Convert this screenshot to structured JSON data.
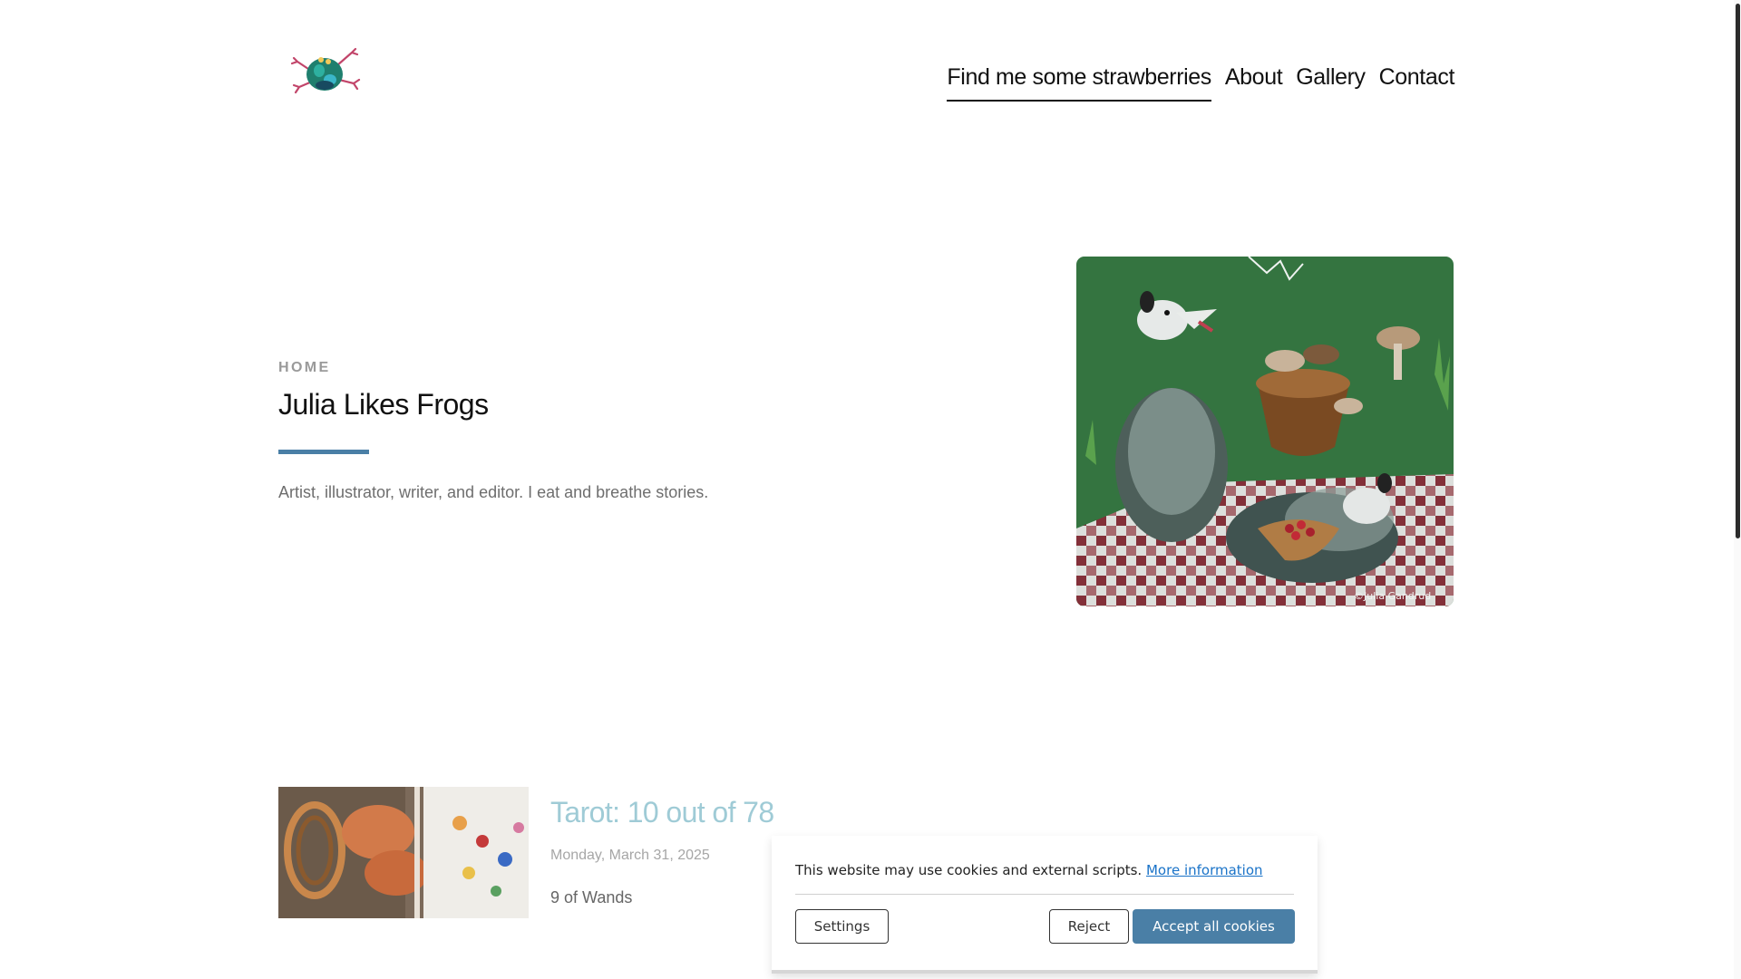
{
  "header": {
    "logo_alt": "frog logo",
    "nav": [
      {
        "label": "Find me some strawberries",
        "active": true
      },
      {
        "label": "About"
      },
      {
        "label": "Gallery"
      },
      {
        "label": "Contact"
      }
    ]
  },
  "hero": {
    "breadcrumb": "HOME",
    "title": "Julia Likes Frogs",
    "tagline": "Artist, illustrator, writer, and editor. I eat and breathe stories.",
    "image_signature": "©Julia Gandrud"
  },
  "post": {
    "title": "Tarot: 10 out of 78",
    "date": "Monday, March 31, 2025",
    "excerpt": "9 of Wands"
  },
  "cookie": {
    "message": "This website may use cookies and external scripts.",
    "link_label": "More information",
    "settings_label": "Settings",
    "reject_label": "Reject",
    "accept_label": "Accept all cookies"
  },
  "colors": {
    "accent": "#4a7fa6",
    "post_title": "#9fcbd6"
  }
}
